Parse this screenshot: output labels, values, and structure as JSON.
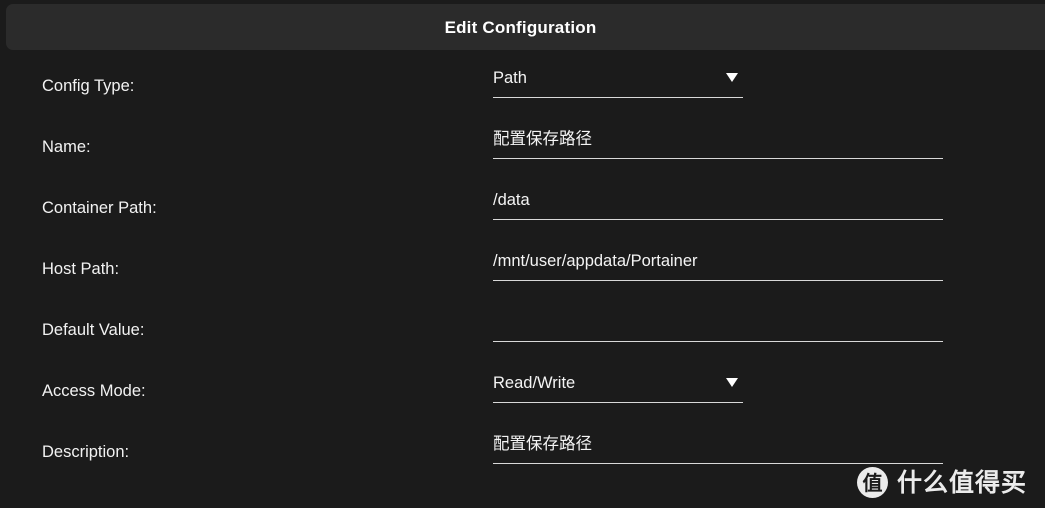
{
  "header": {
    "title": "Edit Configuration"
  },
  "form": {
    "rows": [
      {
        "key": "config_type",
        "label": "Config Type:",
        "kind": "select",
        "value": "Path",
        "placeholder": "",
        "caret_icon": "chevron-down-icon"
      },
      {
        "key": "name",
        "label": "Name:",
        "kind": "text",
        "value": "配置保存路径",
        "placeholder": ""
      },
      {
        "key": "container_path",
        "label": "Container Path:",
        "kind": "text",
        "value": "/data",
        "placeholder": ""
      },
      {
        "key": "host_path",
        "label": "Host Path:",
        "kind": "text",
        "value": "/mnt/user/appdata/Portainer",
        "placeholder": ""
      },
      {
        "key": "default_value",
        "label": "Default Value:",
        "kind": "text",
        "value": "",
        "placeholder": ""
      },
      {
        "key": "access_mode",
        "label": "Access Mode:",
        "kind": "select",
        "value": "Read/Write",
        "placeholder": "",
        "caret_icon": "chevron-down-icon"
      },
      {
        "key": "description",
        "label": "Description:",
        "kind": "text",
        "value": "配置保存路径",
        "placeholder": ""
      }
    ]
  },
  "watermark": {
    "badge": "值",
    "text": "什么值得买"
  },
  "colors": {
    "page_background": "#1b1b1b",
    "header_background": "#2b2b2b",
    "text": "#f2f2f2",
    "underline": "#d9d9d9"
  }
}
